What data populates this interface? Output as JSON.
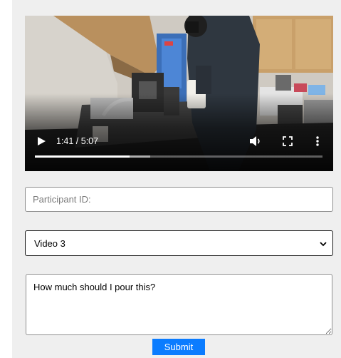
{
  "video": {
    "current_time": "1:41",
    "duration": "5:07",
    "time_display": "1:41 / 5:07",
    "progress_fraction": 0.329,
    "buffered_fraction": 0.4,
    "controls": [
      "play-icon",
      "volume-icon",
      "fullscreen-icon",
      "more-options-icon"
    ]
  },
  "form": {
    "participant_placeholder": "Participant ID:",
    "participant_value": "",
    "video_select": {
      "selected": "Video 3"
    },
    "question_value": "How much should I pour this?",
    "submit_label": "Submit"
  },
  "colors": {
    "page_background": "#efefef",
    "submit_button": "#0b7cff",
    "video_progress": "#ffffff"
  }
}
